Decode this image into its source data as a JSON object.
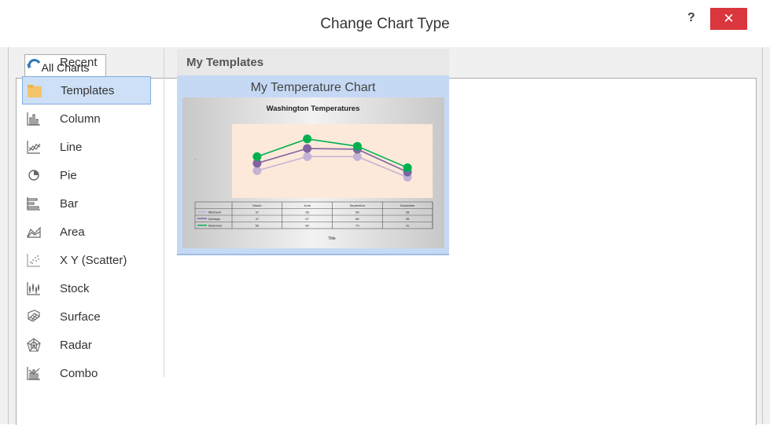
{
  "window": {
    "title": "Change Chart Type",
    "help_label": "?",
    "close_label": "✕"
  },
  "tabs": [
    {
      "label": "All Charts"
    }
  ],
  "categories": [
    {
      "label": "Recent",
      "icon": "recent-icon"
    },
    {
      "label": "Templates",
      "icon": "folder-icon",
      "selected": true
    },
    {
      "label": "Column",
      "icon": "column-chart-icon"
    },
    {
      "label": "Line",
      "icon": "line-chart-icon"
    },
    {
      "label": "Pie",
      "icon": "pie-chart-icon"
    },
    {
      "label": "Bar",
      "icon": "bar-chart-icon"
    },
    {
      "label": "Area",
      "icon": "area-chart-icon"
    },
    {
      "label": "X Y (Scatter)",
      "icon": "scatter-chart-icon"
    },
    {
      "label": "Stock",
      "icon": "stock-chart-icon"
    },
    {
      "label": "Surface",
      "icon": "surface-chart-icon"
    },
    {
      "label": "Radar",
      "icon": "radar-chart-icon"
    },
    {
      "label": "Combo",
      "icon": "combo-chart-icon"
    }
  ],
  "templates": {
    "header": "My Templates",
    "items": [
      {
        "name": "My Temperature Chart"
      }
    ]
  },
  "chart_data": {
    "type": "line",
    "title": "Washington Temperatures",
    "xlabel": "Title",
    "categories": [
      "March",
      "June",
      "September",
      "December"
    ],
    "series": [
      {
        "name": "Minimum",
        "values": [
          37,
          56,
          56,
          28
        ],
        "color": "#c3b4d6"
      },
      {
        "name": "Average",
        "values": [
          47,
          67,
          66,
          35
        ],
        "color": "#8064a2"
      },
      {
        "name": "Maximum",
        "values": [
          56,
          80,
          70,
          41
        ],
        "color": "#00b050"
      }
    ],
    "ylim": [
      0,
      100
    ],
    "legend_position": "data-table",
    "plot_background": "#fde9d9"
  },
  "colors": {
    "accent": "#cde0f7",
    "close_red": "#d9363e",
    "card_bg": "#c6d9f4"
  }
}
